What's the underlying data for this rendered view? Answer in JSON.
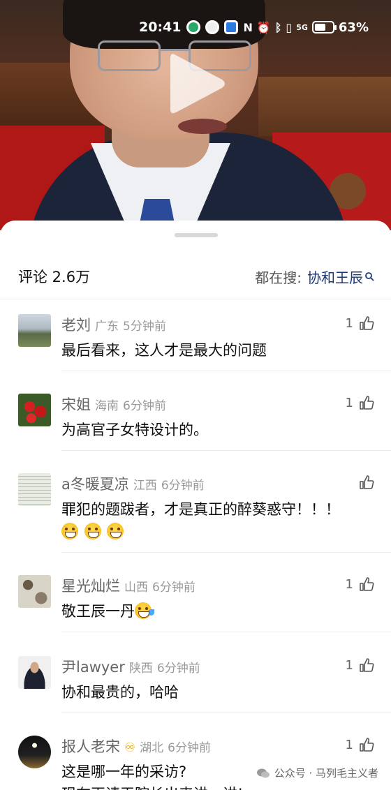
{
  "status_bar": {
    "time": "20:41",
    "nfc": "N",
    "network": "5G",
    "battery_percent": "63%",
    "battery_level": 0.63
  },
  "video": {
    "play_icon": "play-icon"
  },
  "comments_header": {
    "title": "评论 2.6万",
    "search_label": "都在搜:",
    "search_term": "协和王辰",
    "search_icon": "search-icon"
  },
  "comments": [
    {
      "username": "老刘",
      "location": "广东",
      "time": "5分钟前",
      "likes": "1",
      "text": "最后看来，这人才是最大的问题"
    },
    {
      "username": "宋姐",
      "location": "海南",
      "time": "6分钟前",
      "likes": "1",
      "text": "为高官子女特设计的。"
    },
    {
      "username": "a冬暖夏凉",
      "location": "江西",
      "time": "6分钟前",
      "likes": "",
      "text": "罪犯的题跋者，才是真正的醉葵惑守！！！"
    },
    {
      "username": "星光灿烂",
      "location": "山西",
      "time": "6分钟前",
      "likes": "1",
      "text": "敬王辰一丹"
    },
    {
      "username": "尹lawyer",
      "location": "陕西",
      "time": "6分钟前",
      "likes": "1",
      "text": "协和最贵的，哈哈"
    },
    {
      "username": "报人老宋",
      "location": "湖北",
      "time": "6分钟前",
      "likes": "1",
      "text": "这是哪一年的采访?",
      "text2": "现在再请王院长出来讲一讲!"
    }
  ],
  "watermark": {
    "text": "公众号 · 马列毛主义者"
  }
}
